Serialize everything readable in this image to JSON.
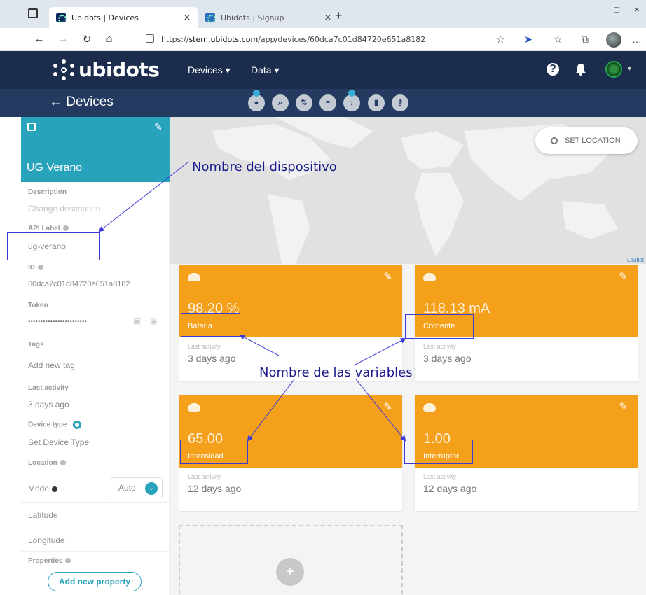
{
  "browser": {
    "tabs": [
      {
        "title": "Ubidots | Devices",
        "close": "×"
      },
      {
        "title": "Ubidots | Signup",
        "close": "×"
      }
    ],
    "new_tab": "+",
    "url_prefix": "https://",
    "url_host": "stem.ubidots.com",
    "url_path": "/app/devices/60dca7c01d84720e651a8182",
    "window_controls": {
      "minimize": "–",
      "maximize": "□",
      "close": "×"
    }
  },
  "header": {
    "logo_text": "ubidots",
    "menu": [
      {
        "label": "Devices ▾"
      },
      {
        "label": "Data ▾"
      }
    ],
    "help_icon": "?",
    "bell_icon": "bell-icon"
  },
  "subbar": {
    "back_label": "← Devices",
    "tools": [
      "device-icon",
      "search-icon",
      "filter-icon",
      "list-icon",
      "export-icon",
      "delete-icon",
      "key-icon"
    ]
  },
  "sidebar": {
    "device_name": "UG Verano",
    "fields": {
      "description_label": "Description",
      "description_placeholder": "Change description",
      "api_label_label": "API Label",
      "api_label_value": "ug-verano",
      "id_label": "ID",
      "id_value": "60dca7c01d84720e651a8182",
      "token_label": "Token",
      "token_value": "••••••••••••••••••••••••",
      "tags_label": "Tags",
      "tags_placeholder": "Add new tag",
      "last_activity_label": "Last activity",
      "last_activity_value": "3 days ago",
      "device_type_label": "Device type",
      "device_type_placeholder": "Set Device Type",
      "location_label": "Location",
      "mode_label": "Mode",
      "mode_value": "Auto",
      "latitude_label": "Latitude",
      "longitude_label": "Longitude",
      "properties_label": "Properties",
      "add_property_label": "Add new property"
    }
  },
  "map": {
    "set_location_label": "SET LOCATION",
    "attribution": "Leaflet"
  },
  "variables": [
    {
      "value": "98.20 %",
      "name": "Bateria",
      "meta": "Last activity",
      "when": "3 days ago"
    },
    {
      "value": "118.13 mA",
      "name": "Corriente",
      "meta": "Last activity",
      "when": "3 days ago"
    },
    {
      "value": "65.00",
      "name": "Intensidad",
      "meta": "Last activity",
      "when": "12 days ago"
    },
    {
      "value": "1.00",
      "name": "Interruptor",
      "meta": "Last activity",
      "when": "12 days ago"
    }
  ],
  "annotations": {
    "device_name_note": "Nombre del dispositivo",
    "variables_note": "Nombre de las variables"
  },
  "colors": {
    "header_bg": "#1c2c4c",
    "subbar_bg": "#243a60",
    "teal_accent": "#27a3bb",
    "card_orange": "#f5a01a",
    "annotation_blue": "#3b3bd8"
  }
}
